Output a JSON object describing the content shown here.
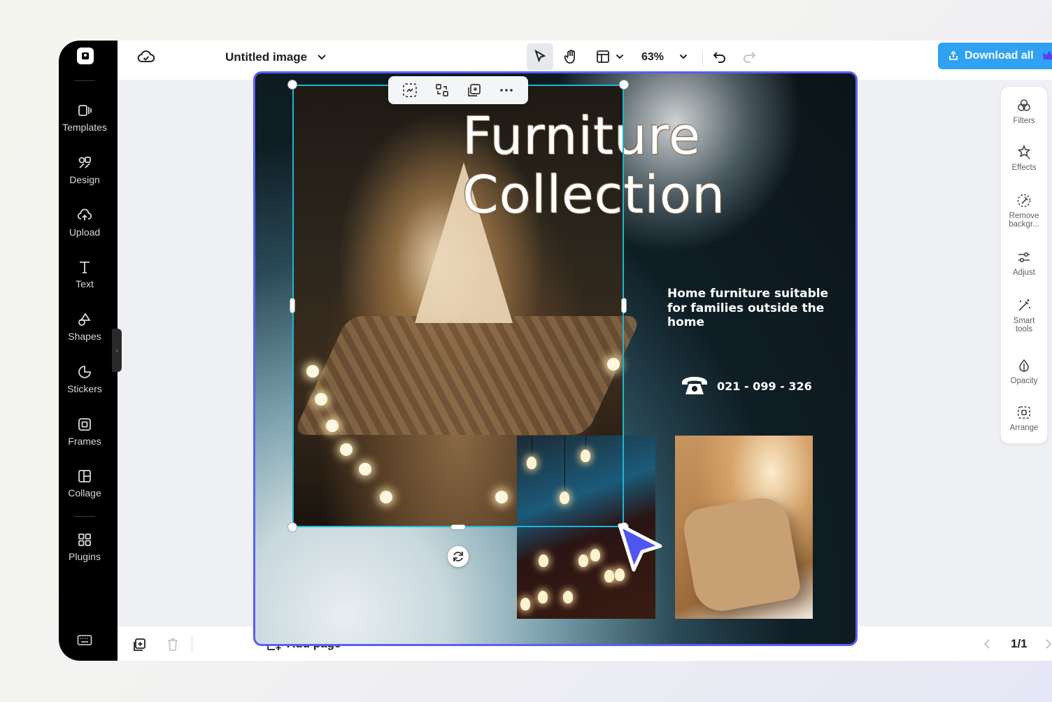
{
  "header": {
    "title": "Untitled image",
    "zoom": "63%",
    "download_label": "Download all"
  },
  "sidebar": {
    "items": [
      {
        "label": "Templates",
        "icon": "templates-icon"
      },
      {
        "label": "Design",
        "icon": "design-icon"
      },
      {
        "label": "Upload",
        "icon": "upload-icon"
      },
      {
        "label": "Text",
        "icon": "text-icon"
      },
      {
        "label": "Shapes",
        "icon": "shapes-icon"
      },
      {
        "label": "Stickers",
        "icon": "stickers-icon"
      },
      {
        "label": "Frames",
        "icon": "frames-icon"
      },
      {
        "label": "Collage",
        "icon": "collage-icon"
      },
      {
        "label": "Plugins",
        "icon": "plugins-icon"
      }
    ]
  },
  "right_panel": {
    "items": [
      {
        "label": "Filters",
        "icon": "filters-icon"
      },
      {
        "label": "Effects",
        "icon": "effects-icon"
      },
      {
        "label": "Remove backgr...",
        "icon": "remove-background-icon"
      },
      {
        "label": "Adjust",
        "icon": "adjust-icon"
      },
      {
        "label": "Smart tools",
        "icon": "smart-tools-icon"
      },
      {
        "label": "Opacity",
        "icon": "opacity-icon"
      },
      {
        "label": "Arrange",
        "icon": "arrange-icon"
      }
    ]
  },
  "canvas": {
    "headline_line1": "Furniture",
    "headline_line2": "Collection",
    "subtext": "Home furniture suitable for families outside the home",
    "phone": "021 - 099 - 326"
  },
  "bottom": {
    "add_page_label": "Add page",
    "page_indicator": "1/1"
  },
  "colors": {
    "accent": "#2fa2f3",
    "selection": "#1fb5d4",
    "canvas_border": "#5a5ef5",
    "cursor": "#4f56f2"
  }
}
